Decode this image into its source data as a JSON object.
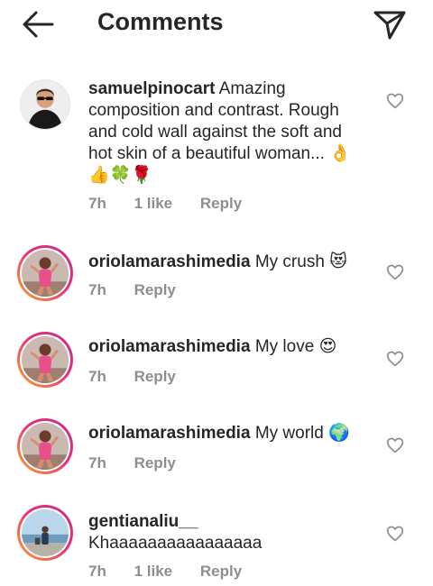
{
  "header": {
    "title": "Comments"
  },
  "comments": [
    {
      "username": "samuelpinocart",
      "text": "Amazing composition and contrast. Rough and cold wall against the soft and hot skin of a beautiful woman...",
      "emoji": "👌👍🍀🌹",
      "time": "7h",
      "likes": "1 like",
      "reply": "Reply"
    },
    {
      "username": "oriolamarashimedia",
      "text": "My crush",
      "emoji": "😻",
      "time": "7h",
      "reply": "Reply"
    },
    {
      "username": "oriolamarashimedia",
      "text": "My love",
      "emoji": "😍",
      "time": "7h",
      "reply": "Reply"
    },
    {
      "username": "oriolamarashimedia",
      "text": "My world",
      "emoji": "🌍",
      "time": "7h",
      "reply": "Reply"
    },
    {
      "username": "gentianaliu__",
      "text": "Khaaaaaaaaaaaaaaaa",
      "time": "7h",
      "likes": "1 like",
      "reply": "Reply"
    }
  ]
}
